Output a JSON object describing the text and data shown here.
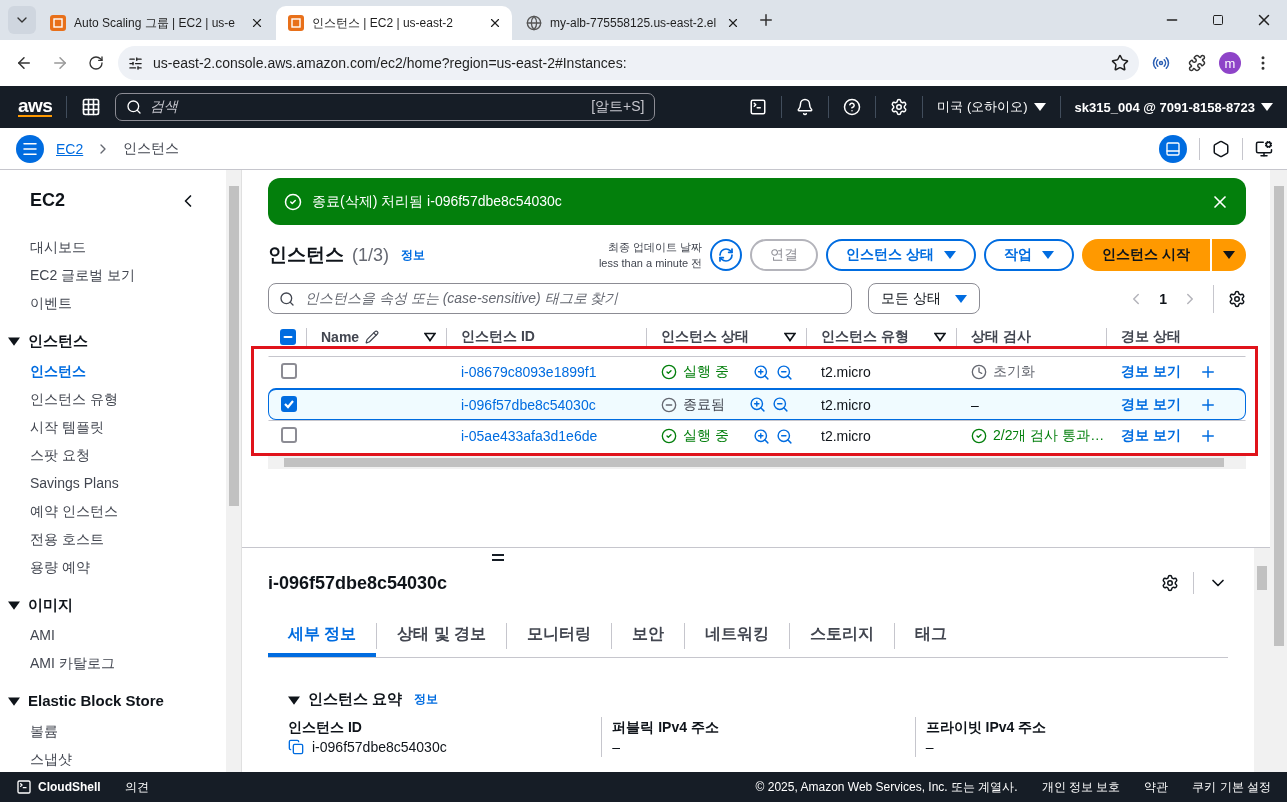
{
  "browser": {
    "tabs": [
      {
        "title": "Auto Scaling 그룹 | EC2 | us-e",
        "selected": false
      },
      {
        "title": "인스턴스 | EC2 | us-east-2",
        "selected": true
      },
      {
        "title": "my-alb-775558125.us-east-2.el",
        "selected": false
      }
    ],
    "url": "us-east-2.console.aws.amazon.com/ec2/home?region=us-east-2#Instances:",
    "profile_initial": "m"
  },
  "console_nav": {
    "logo": "aws",
    "search_placeholder": "검색",
    "shortcut": "[알트+S]",
    "region": "미국 (오하이오)",
    "account": "sk315_004 @ 7091-8158-8723"
  },
  "breadcrumb": [
    "EC2",
    "인스턴스"
  ],
  "sidebar": {
    "title": "EC2",
    "links": [
      {
        "label": "대시보드",
        "selected": false
      },
      {
        "label": "EC2 글로벌 보기",
        "selected": false
      },
      {
        "label": "이벤트",
        "selected": false
      }
    ],
    "sections": [
      {
        "label": "인스턴스",
        "expanded": true,
        "items": [
          {
            "label": "인스턴스",
            "selected": true
          },
          {
            "label": "인스턴스 유형",
            "selected": false
          },
          {
            "label": "시작 템플릿",
            "selected": false
          },
          {
            "label": "스팟 요청",
            "selected": false
          },
          {
            "label": "Savings Plans",
            "selected": false
          },
          {
            "label": "예약 인스턴스",
            "selected": false
          },
          {
            "label": "전용 호스트",
            "selected": false
          },
          {
            "label": "용량 예약",
            "selected": false
          }
        ]
      },
      {
        "label": "이미지",
        "expanded": true,
        "items": [
          {
            "label": "AMI",
            "selected": false
          },
          {
            "label": "AMI 카탈로그",
            "selected": false
          }
        ]
      },
      {
        "label": "Elastic Block Store",
        "expanded": true,
        "items": [
          {
            "label": "볼륨",
            "selected": false
          },
          {
            "label": "스냅샷",
            "selected": false
          }
        ]
      }
    ]
  },
  "flash": {
    "message": "종료(삭제) 처리됨 i-096f57dbe8c54030c"
  },
  "instances": {
    "title": "인스턴스",
    "count": "(1/3)",
    "info": "정보",
    "updated_label": "최종 업데이트 날짜",
    "updated_value": "less than a minute 전",
    "connect": {
      "label": "연결",
      "disabled": true
    },
    "state_menu": "인스턴스 상태",
    "actions_menu": "작업",
    "launch": "인스턴스 시작",
    "search_placeholder": "인스턴스을 속성 또는 (case-sensitive) 태그로 찾기",
    "state_filter": "모든 상태",
    "page": "1",
    "select_all_partial": true,
    "columns": [
      {
        "label": "Name",
        "editable": true,
        "filterable": true
      },
      {
        "label": "인스턴스 ID",
        "editable": false,
        "filterable": false
      },
      {
        "label": "인스턴스 상태",
        "editable": false,
        "filterable": true
      },
      {
        "label": "인스턴스 유형",
        "editable": false,
        "filterable": true
      },
      {
        "label": "상태 검사",
        "editable": false,
        "filterable": false
      },
      {
        "label": "경보 상태",
        "editable": false,
        "filterable": false
      }
    ],
    "rows": [
      {
        "selected": false,
        "id": "i-08679c8093e1899f1",
        "state": {
          "label": "실행 중",
          "kind": "running"
        },
        "type": "t2.micro",
        "check": {
          "label": "초기화",
          "kind": "pending"
        },
        "alarm": "경보 보기"
      },
      {
        "selected": true,
        "id": "i-096f57dbe8c54030c",
        "state": {
          "label": "종료됨",
          "kind": "terminated"
        },
        "type": "t2.micro",
        "check": {
          "label": "–",
          "kind": "none"
        },
        "alarm": "경보 보기"
      },
      {
        "selected": false,
        "id": "i-05ae433afa3d1e6de",
        "state": {
          "label": "실행 중",
          "kind": "running"
        },
        "type": "t2.micro",
        "check": {
          "label": "2/2개 검사 통과…",
          "kind": "passed"
        },
        "alarm": "경보 보기"
      }
    ]
  },
  "details": {
    "title": "i-096f57dbe8c54030c",
    "tabs": [
      {
        "label": "세부 정보",
        "selected": true
      },
      {
        "label": "상태 및 경보",
        "selected": false
      },
      {
        "label": "모니터링",
        "selected": false
      },
      {
        "label": "보안",
        "selected": false
      },
      {
        "label": "네트워킹",
        "selected": false
      },
      {
        "label": "스토리지",
        "selected": false
      },
      {
        "label": "태그",
        "selected": false
      }
    ],
    "section": {
      "title": "인스턴스 요약",
      "info": "정보",
      "expanded": true
    },
    "fields": [
      {
        "label": "인스턴스 ID",
        "value": "i-096f57dbe8c54030c",
        "copyable": true
      },
      {
        "label": "퍼블릭 IPv4 주소",
        "value": "–",
        "copyable": false
      },
      {
        "label": "프라이빗 IPv4 주소",
        "value": "–",
        "copyable": false
      }
    ]
  },
  "footer": {
    "cloudshell": "CloudShell",
    "feedback": "의견",
    "copyright": "© 2025, Amazon Web Services, Inc. 또는 계열사.",
    "links": [
      "개인 정보 보호",
      "약관",
      "쿠키 기본 설정"
    ]
  }
}
